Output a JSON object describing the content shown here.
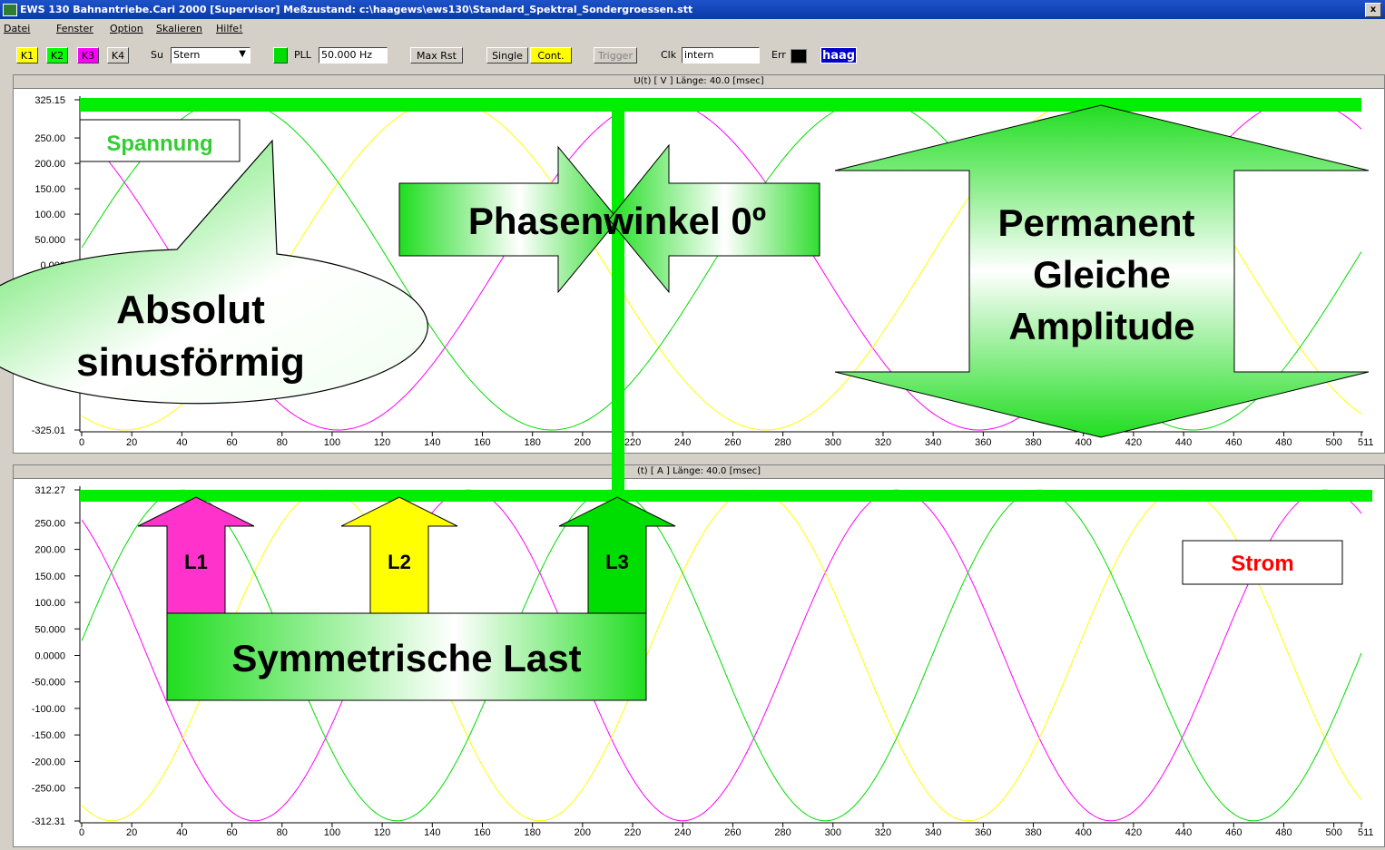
{
  "window": {
    "title": "EWS 130  Bahnantriebe.Cari 2000  [Supervisor]  Meßzustand: c:\\haagews\\ews130\\Standard_Spektral_Sondergroessen.stt",
    "close_label": "x"
  },
  "menu": [
    "Datei",
    "Fenster",
    "Option",
    "Skalieren",
    "Hilfe!"
  ],
  "toolbar": {
    "channels": [
      "K1",
      "K2",
      "K3",
      "K4"
    ],
    "su_label": "Su",
    "su_value": "Stern",
    "pll_label": "PLL",
    "pll_value": "50.000 Hz",
    "max_rst": "Max Rst",
    "single": "Single",
    "cont": "Cont.",
    "trigger": "Trigger",
    "clk_label": "Clk",
    "clk_value": "intern",
    "err_label": "Err",
    "logo": "haag"
  },
  "colors": {
    "L1": "#ff00ff",
    "L2": "#ffff00",
    "L3": "#00dd00",
    "marker": "#00ee00"
  },
  "annotations": {
    "spannung": "Spannung",
    "absolut_line1": "Absolut",
    "absolut_line2": "sinusförmig",
    "phasenwinkel": "Phasenwinkel 0º",
    "permanent_line1": "Permanent",
    "permanent_line2": "Gleiche",
    "permanent_line3": "Amplitude",
    "L1": "L1",
    "L2": "L2",
    "L3": "L3",
    "symmetrische_last": "Symmetrische Last",
    "strom": "Strom"
  },
  "chart_data": [
    {
      "type": "line",
      "header": "U(t) [ V ]      Länge: 40.0 [msec]",
      "header_visible": "U(t) [ V ]      Länge: 40.0 [msec]",
      "ylim": [
        -325.01,
        325.15
      ],
      "y_ticks": [
        "325.15",
        "250.00",
        "200.00",
        "150.00",
        "100.00",
        "50.000",
        "0.000",
        "-325.01"
      ],
      "y_tick_values": [
        325.15,
        250,
        200,
        150,
        100,
        50,
        0,
        -325.01
      ],
      "xlim": [
        0,
        511
      ],
      "x_ticks": [
        "0",
        "20",
        "40",
        "60",
        "80",
        "100",
        "120",
        "140",
        "160",
        "180",
        "200",
        "220",
        "240",
        "260",
        "280",
        "300",
        "320",
        "340",
        "360",
        "380",
        "400",
        "420",
        "440",
        "460",
        "480",
        "500",
        "511"
      ],
      "series": [
        {
          "name": "L1",
          "amplitude": 325,
          "period_samples": 256,
          "phase_deg": 126
        },
        {
          "name": "L2",
          "amplitude": 325,
          "period_samples": 256,
          "phase_deg": 246
        },
        {
          "name": "L3",
          "amplitude": 325,
          "period_samples": 256,
          "phase_deg": 6
        }
      ],
      "marker_level": 325.15,
      "marker_x": 213
    },
    {
      "type": "line",
      "header": "I(t) [ A ]      Länge: 40.0 [msec]",
      "header_visible": "(t) [ A ]      Länge: 40.0 [msec]",
      "ylim": [
        -312.31,
        312.27
      ],
      "y_ticks": [
        "312.27",
        "250.00",
        "200.00",
        "150.00",
        "100.00",
        "50.000",
        "0.0000",
        "-50.000",
        "-100.00",
        "-150.00",
        "-200.00",
        "-250.00",
        "-312.31"
      ],
      "y_tick_values": [
        312.27,
        250,
        200,
        150,
        100,
        50,
        0,
        -50,
        -100,
        -150,
        -200,
        -250,
        -312.31
      ],
      "xlim": [
        0,
        511
      ],
      "x_ticks": [
        "0",
        "20",
        "40",
        "60",
        "80",
        "100",
        "120",
        "140",
        "160",
        "180",
        "200",
        "220",
        "240",
        "260",
        "280",
        "300",
        "320",
        "340",
        "360",
        "380",
        "400",
        "420",
        "440",
        "460",
        "480",
        "500",
        "511"
      ],
      "series": [
        {
          "name": "L1",
          "amplitude": 312,
          "period_samples": 171,
          "phase_deg": 125
        },
        {
          "name": "L2",
          "amplitude": 312,
          "period_samples": 171,
          "phase_deg": 245
        },
        {
          "name": "L3",
          "amplitude": 312,
          "period_samples": 171,
          "phase_deg": 5
        }
      ],
      "marker_level": 312.27
    }
  ]
}
